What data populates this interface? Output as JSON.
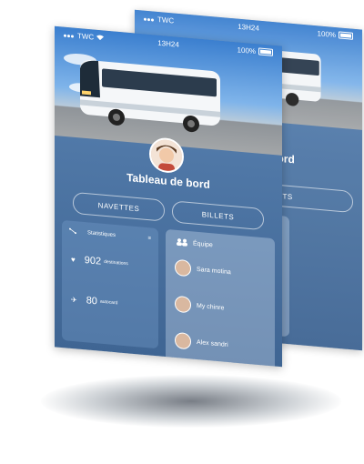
{
  "status": {
    "carrier": "TWC",
    "time": "13H24",
    "battery": "100%"
  },
  "header": {
    "title": "Tableau de bord"
  },
  "tabs": [
    {
      "label": "NAVETTES"
    },
    {
      "label": "BILLETS"
    }
  ],
  "stats": {
    "label": "Statistiques",
    "items": [
      {
        "value": "902",
        "unit": "destinations",
        "icon": "heart-icon"
      },
      {
        "value": "80",
        "unit": "autocard",
        "icon": "pin-icon"
      }
    ]
  },
  "team": {
    "label": "Équipe",
    "members": [
      {
        "name": "Sara motina"
      },
      {
        "name": "My chinre"
      },
      {
        "name": "Alex sandri"
      }
    ]
  },
  "colors": {
    "panel": "#4f77a6",
    "sky": "#3b7fcf",
    "text": "#ffffff"
  }
}
